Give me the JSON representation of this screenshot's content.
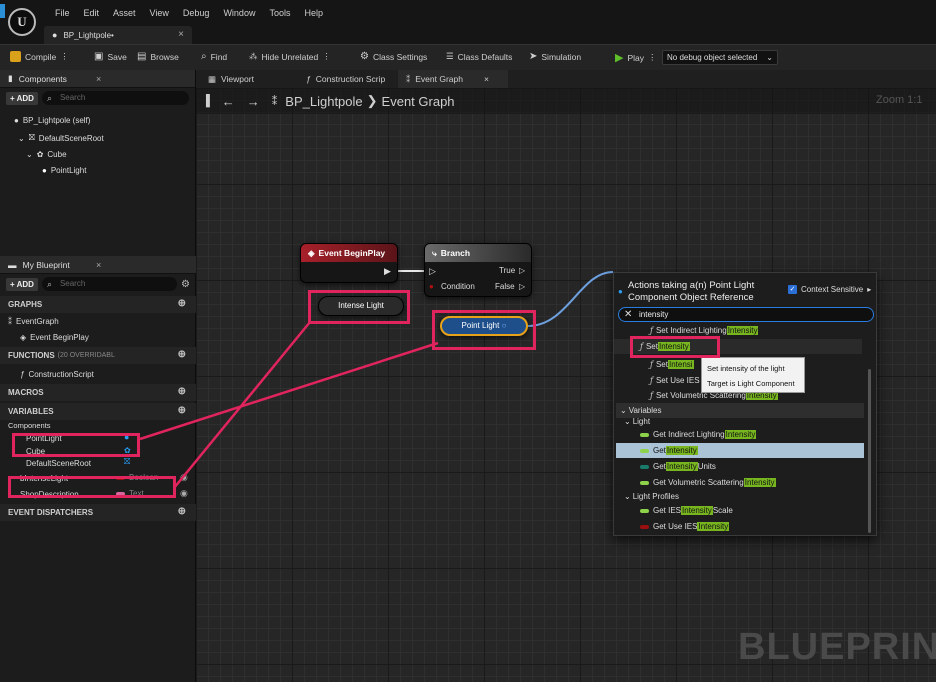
{
  "menu": [
    "File",
    "Edit",
    "Asset",
    "View",
    "Debug",
    "Window",
    "Tools",
    "Help"
  ],
  "document_tab": "BP_Lightpole•",
  "toolbar": {
    "compile": "Compile",
    "save": "Save",
    "browse": "Browse",
    "find": "Find",
    "hide_unrelated": "Hide Unrelated",
    "class_settings": "Class Settings",
    "class_defaults": "Class Defaults",
    "simulation": "Simulation",
    "play": "Play",
    "debug_object": "No debug object selected"
  },
  "components_panel": {
    "tab": "Components",
    "add": "+ ADD",
    "search_placeholder": "Search",
    "self": "BP_Lightpole (self)",
    "tree": [
      "DefaultSceneRoot",
      "Cube",
      "PointLight"
    ]
  },
  "my_blueprint": {
    "tab": "My Blueprint",
    "add": "+ ADD",
    "search_placeholder": "Search",
    "graphs_header": "GRAPHS",
    "event_graph": "EventGraph",
    "event_beginplay": "Event BeginPlay",
    "functions_header": "FUNCTIONS",
    "functions_overridable": "(20 OVERRIDABL",
    "construction_script": "ConstructionScript",
    "macros_header": "MACROS",
    "variables_header": "VARIABLES",
    "components_label": "Components",
    "variables": [
      {
        "name": "PointLight",
        "type": ""
      },
      {
        "name": "Cube",
        "type": ""
      },
      {
        "name": "DefaultSceneRoot",
        "type": ""
      },
      {
        "name": "bIntenseLight",
        "type": "Boolean"
      },
      {
        "name": "ShopDescription",
        "type": "Text"
      }
    ],
    "event_dispatchers_header": "EVENT DISPATCHERS"
  },
  "graph_tabs": [
    "Viewport",
    "Construction Scrip",
    "Event Graph"
  ],
  "breadcrumb": {
    "blueprint": "BP_Lightpole",
    "graph": "Event Graph"
  },
  "zoom": "Zoom 1:1",
  "watermark": "BLUEPRINT",
  "nodes": {
    "begin_play": "Event BeginPlay",
    "branch": "Branch",
    "condition": "Condition",
    "true": "True",
    "false": "False",
    "intense_light": "Intense Light",
    "point_light": "Point Light"
  },
  "popup": {
    "title": "Actions taking a(n) Point Light Component Object Reference",
    "context_sensitive": "Context Sensitive",
    "search_value": "intensity",
    "tooltip_line1": "Set intensity of the light",
    "tooltip_line2": "Target is Light Component",
    "variables_cat": "Variables",
    "light_cat": "Light",
    "light_profiles_cat": "Light Profiles",
    "fn_rows": [
      {
        "pre": "Set Indirect Lighting ",
        "hl": "Intensity",
        "post": ""
      },
      {
        "pre": "Set ",
        "hl": "Intensity",
        "post": ""
      },
      {
        "pre": "Set ",
        "hl": "Intensi",
        "post": ""
      },
      {
        "pre": "Set Use IES",
        "hl": "",
        "post": ""
      },
      {
        "pre": "Set Volumetric Scattering ",
        "hl": "Intensity",
        "post": ""
      }
    ],
    "var_rows": [
      {
        "pre": "Get Indirect Lighting ",
        "hl": "Intensity",
        "post": ""
      },
      {
        "pre": "Get ",
        "hl": "Intensity",
        "post": ""
      },
      {
        "pre": "Get ",
        "hl": "Intensity",
        "post": " Units"
      },
      {
        "pre": "Get Volumetric Scattering ",
        "hl": "Intensity",
        "post": ""
      }
    ],
    "profile_rows": [
      {
        "pre": "Get IES ",
        "hl": "Intensity",
        "post": " Scale"
      },
      {
        "pre": "Get Use IES ",
        "hl": "Intensity",
        "post": ""
      }
    ]
  },
  "colors": {
    "accent_blue": "#2a8fd6",
    "highlight_green": "#78b620",
    "annotation_red": "#e0245e",
    "event_red": "#a8202a",
    "object_blue": "#1e88e5"
  }
}
